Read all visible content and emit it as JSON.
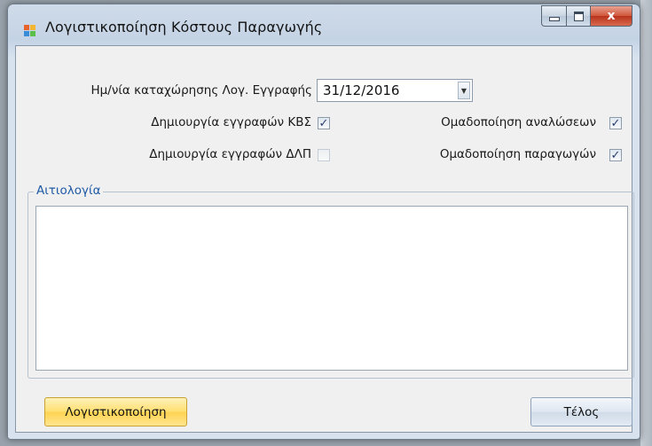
{
  "window": {
    "title": "Λογιστικοποίηση Κόστους Παραγωγής",
    "close_glyph": "x",
    "icon": "app-grid-icon"
  },
  "form": {
    "date_label": "Ημ/νία καταχώρησης Λογ. Εγγραφής",
    "date_value": "31/12/2016",
    "options": [
      {
        "label": "Δημιουργία εγγραφών ΚΒΣ",
        "checked": true
      },
      {
        "label": "Ομαδοποίηση αναλώσεων",
        "checked": true
      },
      {
        "label": "Δημιουργία εγγραφών ΔΛΠ",
        "checked": false
      },
      {
        "label": "Ομαδοποίηση παραγωγών",
        "checked": true
      }
    ],
    "group_title": "Αιτιολογία",
    "memo_value": ""
  },
  "buttons": {
    "post_label": "Λογιστικοποίηση",
    "end_label": "Τέλος"
  },
  "colors": {
    "accent_post": "#ffd351",
    "group_title": "#1f5aa6",
    "close": "#c43b22"
  }
}
